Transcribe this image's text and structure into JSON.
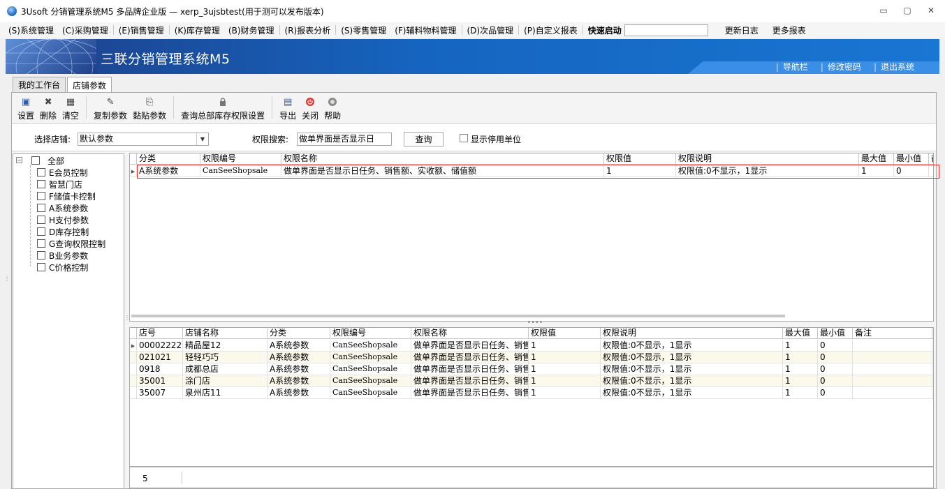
{
  "window": {
    "title": "3Usoft 分销管理系统M5 多品牌企业版 — xerp_3ujsbtest(用于测可以发布版本)",
    "controls": [
      "▭",
      "▢",
      "✕"
    ]
  },
  "menu": {
    "items": [
      "(S)系统管理",
      "(C)采购管理",
      "(E)销售管理",
      "(K)库存管理",
      "(B)财务管理",
      "(R)报表分析",
      "(S)零售管理",
      "(F)辅料物料管理",
      "(D)次品管理",
      "(P)自定义报表"
    ],
    "quick_launch_label": "快速启动",
    "quick_launch_value": "",
    "extra": [
      "更新日志",
      "更多报表"
    ]
  },
  "banner": {
    "system_name": "三联分销管理系统M5",
    "links": [
      "导航栏",
      "修改密码",
      "退出系统"
    ]
  },
  "tabs": [
    {
      "label": "我的工作台",
      "active": false
    },
    {
      "label": "店铺参数",
      "active": true
    }
  ],
  "toolbar": {
    "buttons": [
      {
        "label": "设置",
        "icon": "save-icon",
        "glyph": "▣",
        "color": "#2a5db0"
      },
      {
        "label": "删除",
        "icon": "delete-icon",
        "glyph": "✖",
        "color": "#555555"
      },
      {
        "label": "清空",
        "icon": "clear-icon",
        "glyph": "▦",
        "color": "#444444"
      },
      {
        "label": "复制参数",
        "icon": "copy-icon",
        "glyph": "✎",
        "color": "#444444"
      },
      {
        "label": "黏贴参数",
        "icon": "paste-icon",
        "glyph": "⎘",
        "color": "#444444"
      },
      {
        "label": "查询总部库存权限设置",
        "icon": "lock-icon",
        "glyph": "🔒",
        "color": "#666666"
      },
      {
        "label": "导出",
        "icon": "export-icon",
        "glyph": "▤",
        "color": "#2a5db0"
      },
      {
        "label": "关闭",
        "icon": "close-icon",
        "glyph": "⏻",
        "color": "#d32f2f"
      },
      {
        "label": "帮助",
        "icon": "help-icon",
        "glyph": "?",
        "color": "#555555"
      }
    ]
  },
  "filter": {
    "shop_label": "选择店铺:",
    "shop_value": "默认参数",
    "perm_label": "权限搜索:",
    "perm_value": "做单界面是否显示日",
    "query_button": "查询",
    "show_disabled_label": "显示停用单位",
    "show_disabled_checked": false
  },
  "tree": {
    "root": "全部",
    "items": [
      "E会员控制",
      "智慧门店",
      "F储值卡控制",
      "A系统参数",
      "H支付参数",
      "D库存控制",
      "G查询权限控制",
      "B业务参数",
      "C价格控制"
    ]
  },
  "top_grid": {
    "columns": [
      "分类",
      "权限编号",
      "权限名称",
      "权限值",
      "权限说明",
      "最大值",
      "最小值",
      "备"
    ],
    "rows": [
      [
        "A系统参数",
        "CanSeeShopsale",
        "做单界面是否显示日任务、销售额、实收额、储值额",
        "1",
        "权限值:0不显示，1显示",
        "1",
        "0",
        ""
      ]
    ]
  },
  "bottom_grid": {
    "columns": [
      "店号",
      "店铺名称",
      "分类",
      "权限编号",
      "权限名称",
      "权限值",
      "权限说明",
      "最大值",
      "最小值",
      "备注"
    ],
    "rows": [
      [
        "00002222",
        "精品屋12",
        "A系统参数",
        "CanSeeShopsale",
        "做单界面是否显示日任务、销售额",
        "1",
        "权限值:0不显示，1显示",
        "1",
        "0",
        ""
      ],
      [
        "021021",
        "轻轻巧巧",
        "A系统参数",
        "CanSeeShopsale",
        "做单界面是否显示日任务、销售额",
        "1",
        "权限值:0不显示，1显示",
        "1",
        "0",
        ""
      ],
      [
        "0918",
        "成都总店",
        "A系统参数",
        "CanSeeShopsale",
        "做单界面是否显示日任务、销售额",
        "1",
        "权限值:0不显示，1显示",
        "1",
        "0",
        ""
      ],
      [
        "35001",
        "涂门店",
        "A系统参数",
        "CanSeeShopsale",
        "做单界面是否显示日任务、销售额",
        "1",
        "权限值:0不显示，1显示",
        "1",
        "0",
        ""
      ],
      [
        "35007",
        "泉州店11",
        "A系统参数",
        "CanSeeShopsale",
        "做单界面是否显示日任务、销售额",
        "1",
        "权限值:0不显示，1显示",
        "1",
        "0",
        ""
      ]
    ]
  },
  "footer": {
    "record_count": "5"
  },
  "colors": {
    "banner": "#1565c0",
    "highlight": "#e03030",
    "alt_row": "#fbf8ec"
  }
}
